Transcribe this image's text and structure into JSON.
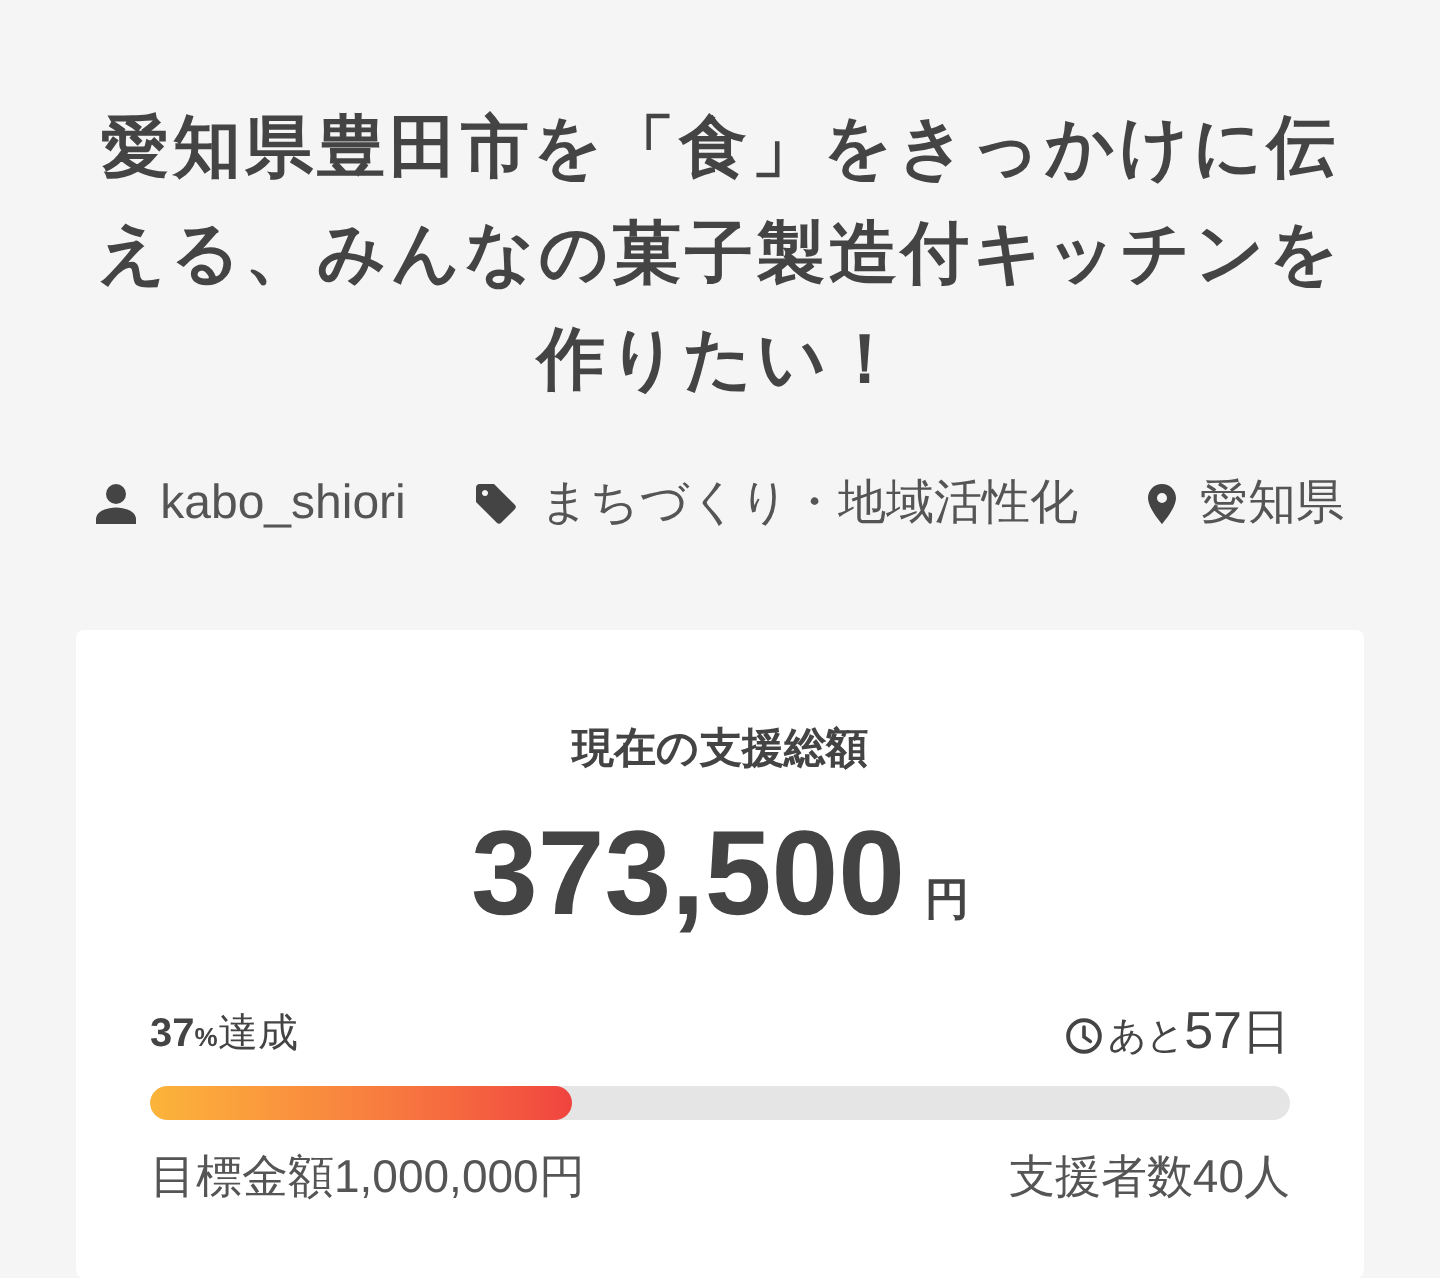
{
  "project": {
    "title": "愛知県豊田市を「食」をきっかけに伝える、みんなの菓子製造付キッチンを作りたい！",
    "meta": [
      {
        "kind": "user",
        "text": "kabo_shiori"
      },
      {
        "kind": "tag",
        "text": "まちづくり・地域活性化"
      },
      {
        "kind": "location",
        "text": "愛知県"
      }
    ]
  },
  "funding": {
    "label": "現在の支援総額",
    "amount": "373,500",
    "currency": "円",
    "achievement": {
      "value": "37",
      "unit": "%",
      "suffix": "達成"
    },
    "remaining": {
      "prefix": "あと",
      "value": "57",
      "unit": "日"
    },
    "progress": {
      "level": 0.37
    },
    "goal": "目標金額1,000,000円",
    "backers": "支援者数40人"
  }
}
